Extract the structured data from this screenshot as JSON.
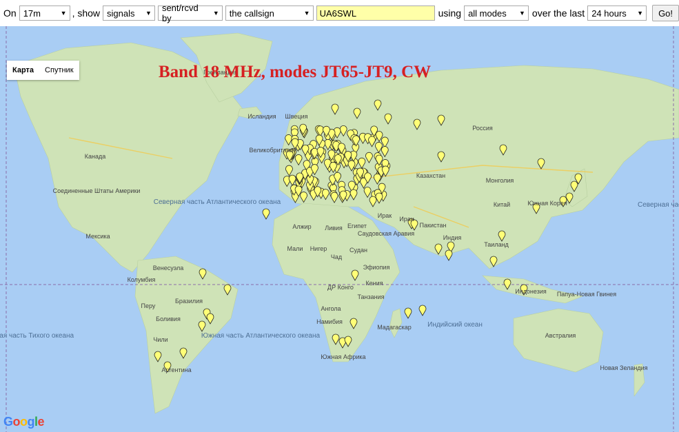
{
  "toolbar": {
    "on_label": "On",
    "band": "17m",
    "show_label": ", show",
    "show_value": "signals",
    "direction": "sent/rcvd by",
    "target": "the callsign",
    "callsign": "UA6SWL",
    "using_label": "using",
    "mode": "all modes",
    "over_label": "over the last",
    "period": "24 hours",
    "go_label": "Go!"
  },
  "map": {
    "type_buttons": [
      "Карта",
      "Спутник"
    ],
    "title": "Band 18 MHz, modes JT65-JT9, CW",
    "logo": "Google",
    "labels": {
      "greenland": "Гренландия",
      "iceland": "Исландия",
      "canada": "Канада",
      "usa": "Соединенные Штаты Америки",
      "mexico": "Мексика",
      "n_atlantic": "Северная часть Атлантического океана",
      "russia": "Россия",
      "kazakhstan": "Казахстан",
      "mongolia": "Монголия",
      "china": "Китай",
      "iraq": "Ирак",
      "iran": "Иран",
      "pakistan": "Пакистан",
      "india": "Индия",
      "saudi": "Саудовская Аравия",
      "egypt": "Египет",
      "libya": "Ливия",
      "algeria": "Алжир",
      "mali": "Мали",
      "niger": "Нигер",
      "chad": "Чад",
      "sudan": "Судан",
      "ethiopia": "Эфиопия",
      "kenya": "Кения",
      "tanzania": "Танзания",
      "drc": "ДР Конго",
      "angola": "Ангола",
      "namibia": "Намибия",
      "madagascar": "Мадагаскар",
      "s_africa": "Южная Африка",
      "s_atlantic": "Южная часть Атлантического океана",
      "indian_ocean": "Индийский океан",
      "s_pacific": "Южная часть Тихого океана",
      "n_pacific": "Северная часть",
      "venezuela": "Венесуэла",
      "colombia": "Колумбия",
      "peru": "Перу",
      "brazil": "Бразилия",
      "bolivia": "Боливия",
      "chile": "Чили",
      "argentina": "Аргентина",
      "australia": "Австралия",
      "png": "Папуа-Новая Гвинея",
      "nz": "Новая Зеландия",
      "thailand": "Таиланд",
      "indonesia": "Индонезия",
      "korea": "Южная Корея",
      "sweden": "Швеция",
      "uk": "Великобритания"
    }
  },
  "colors": {
    "accent_title": "#d62022",
    "marker_fill": "#ffff77",
    "ocean": "#a9cdf4",
    "land": "#cfe3b7"
  }
}
